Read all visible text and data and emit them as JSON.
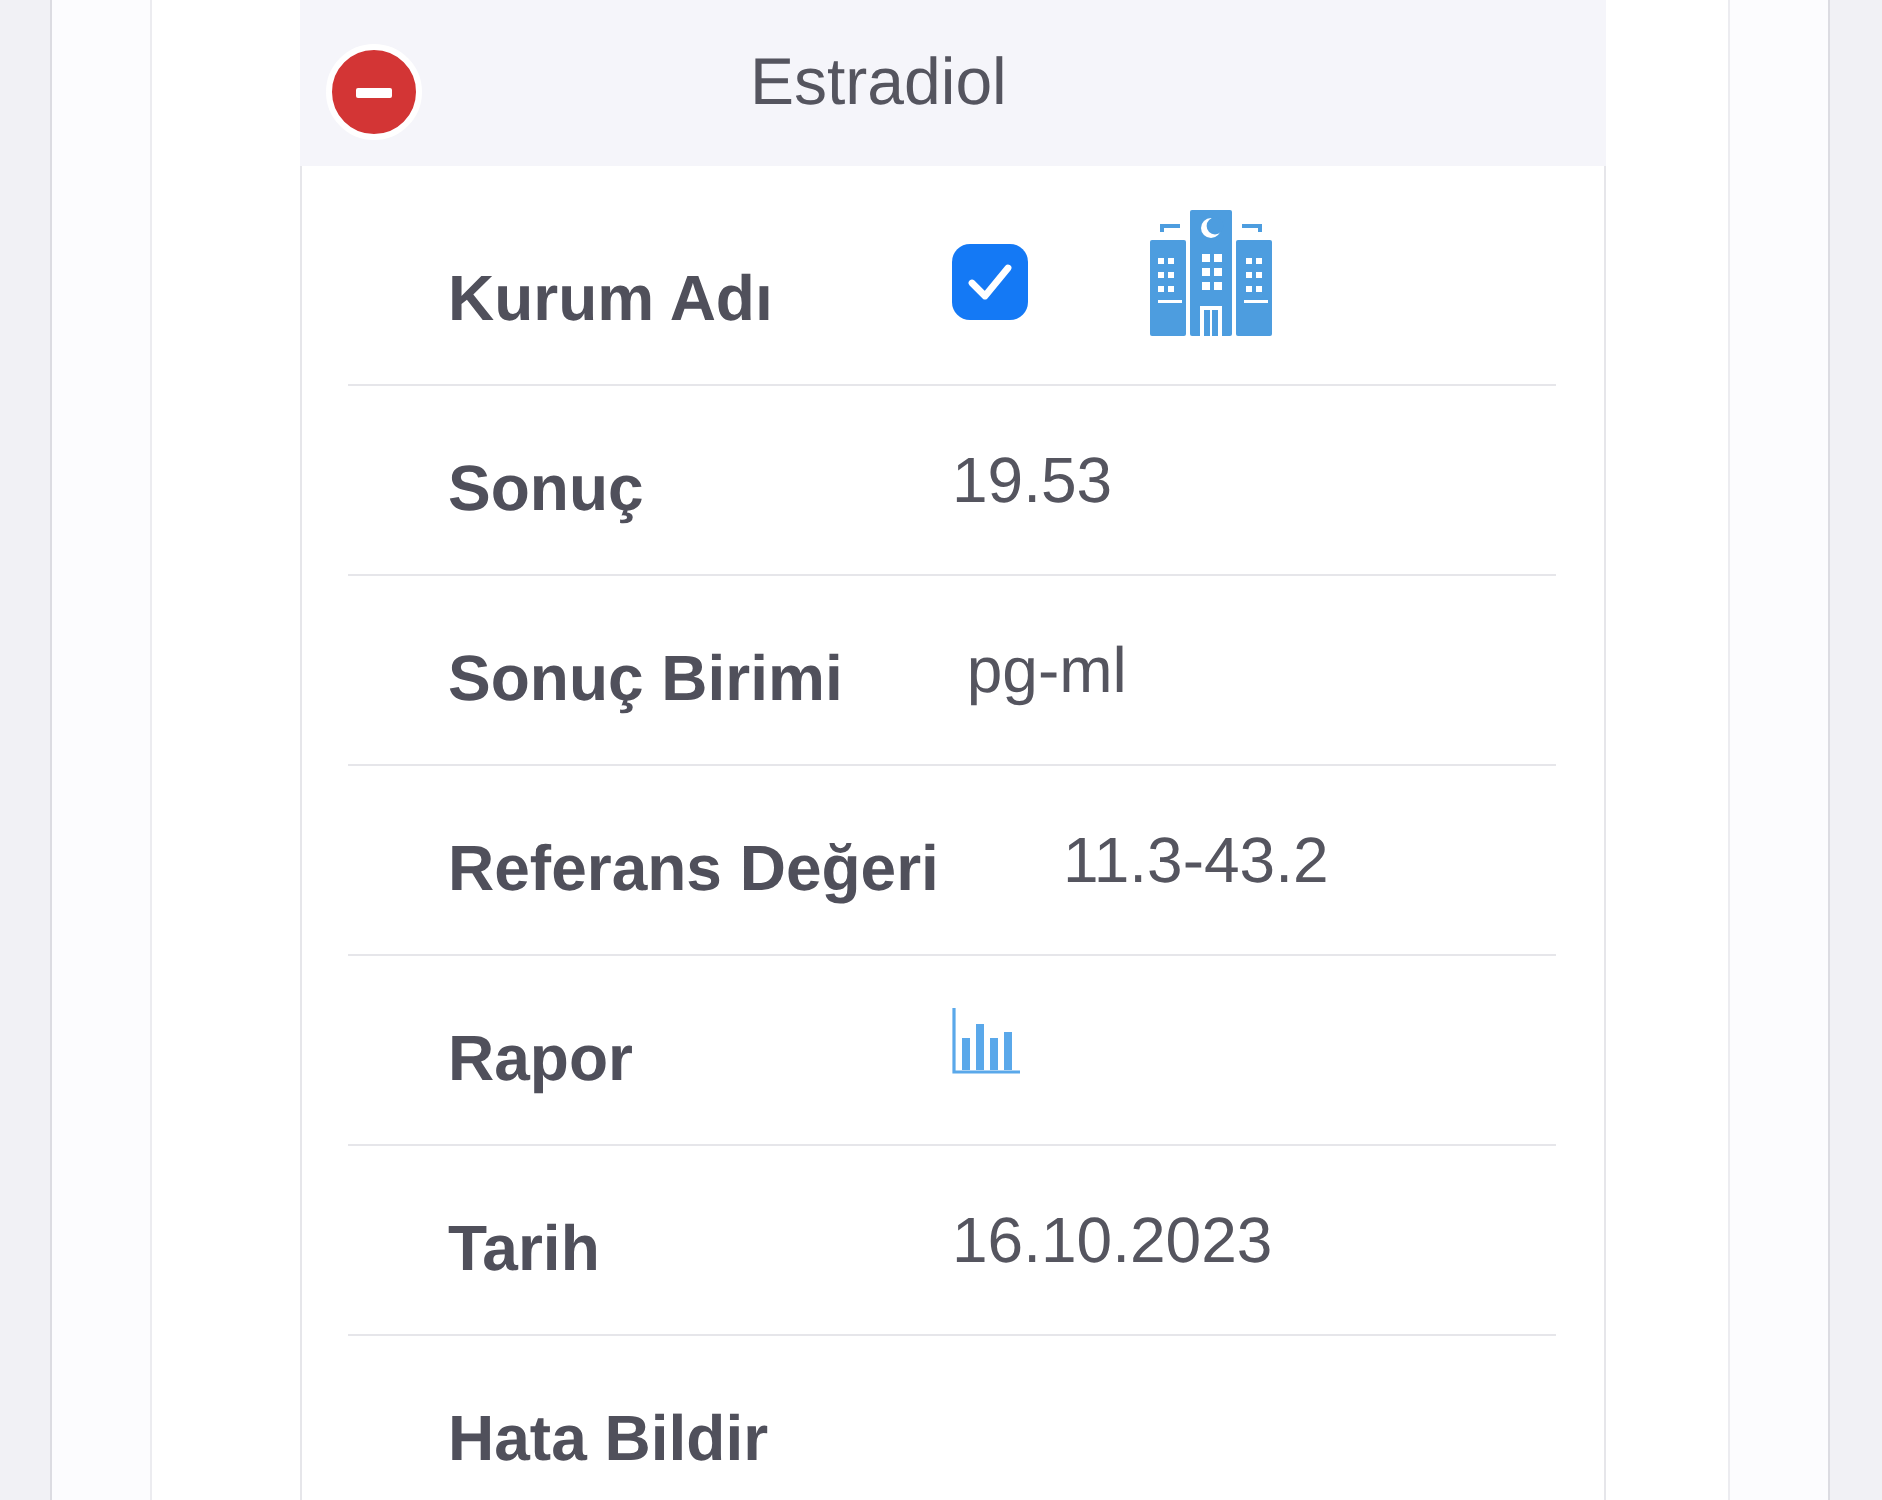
{
  "card": {
    "title": "Estradiol",
    "expanded": true
  },
  "rows": [
    {
      "kind": "institution",
      "label": "Kurum Adı",
      "checked": true
    },
    {
      "kind": "text",
      "label": "Sonuç",
      "value": "19.53"
    },
    {
      "kind": "text",
      "label": "Sonuç Birimi",
      "value": "pg-ml"
    },
    {
      "kind": "text",
      "label": "Referans Değeri",
      "value": "11.3-43.2"
    },
    {
      "kind": "report",
      "label": "Rapor"
    },
    {
      "kind": "text",
      "label": "Tarih",
      "value": "16.10.2023"
    },
    {
      "kind": "empty",
      "label": "Hata Bildir"
    }
  ]
}
